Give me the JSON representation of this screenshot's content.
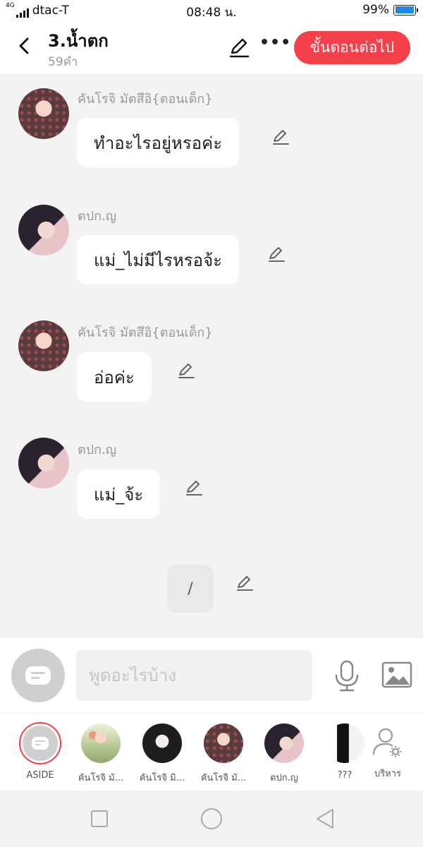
{
  "status_bar": {
    "network": "4G",
    "carrier": "dtac-T",
    "time": "08:48 น.",
    "battery": "99%",
    "battery_level": 0.99
  },
  "header": {
    "title": "3.น้ำตก",
    "word_count": "59คำ",
    "next_button": "ขั้นตอนต่อไป"
  },
  "messages": [
    {
      "sender": "คันโรจิ มัตสึอิ{ตอนเด็ก}",
      "text": "ทำอะไรอยู่หรอค่ะ",
      "avatar": "pink-kimono-girl"
    },
    {
      "sender": "ตปก.ญ",
      "text": "แม่_ไม่มีไรหรอจ้ะ",
      "avatar": "dark-hair-girl"
    },
    {
      "sender": "คันโรจิ มัตสึอิ{ตอนเด็ก}",
      "text": "อ่อค่ะ",
      "avatar": "pink-kimono-girl"
    },
    {
      "sender": "ตปก.ญ",
      "text": "แม่_จ้ะ",
      "avatar": "dark-hair-girl"
    }
  ],
  "pending_bubble": "/",
  "composer": {
    "placeholder": "พูดอะไรบ้าง"
  },
  "characters": [
    {
      "label": "ASIDE",
      "selected": true
    },
    {
      "label": "คันโรจิ มั...",
      "avatar": "green-dress-girl"
    },
    {
      "label": "คันโรจิ มิ...",
      "avatar": "black-white-boy"
    },
    {
      "label": "คันโรจิ มั...",
      "avatar": "pink-kimono-girl"
    },
    {
      "label": "ตปก.ญ",
      "avatar": "dark-hair-girl"
    },
    {
      "label": "???",
      "avatar": "silhouette"
    },
    {
      "label": "บริหาร",
      "avatar": "admin-icon"
    }
  ],
  "colors": {
    "accent": "#f4404a",
    "background": "#f3f3f3",
    "battery": "#1e88e5"
  }
}
